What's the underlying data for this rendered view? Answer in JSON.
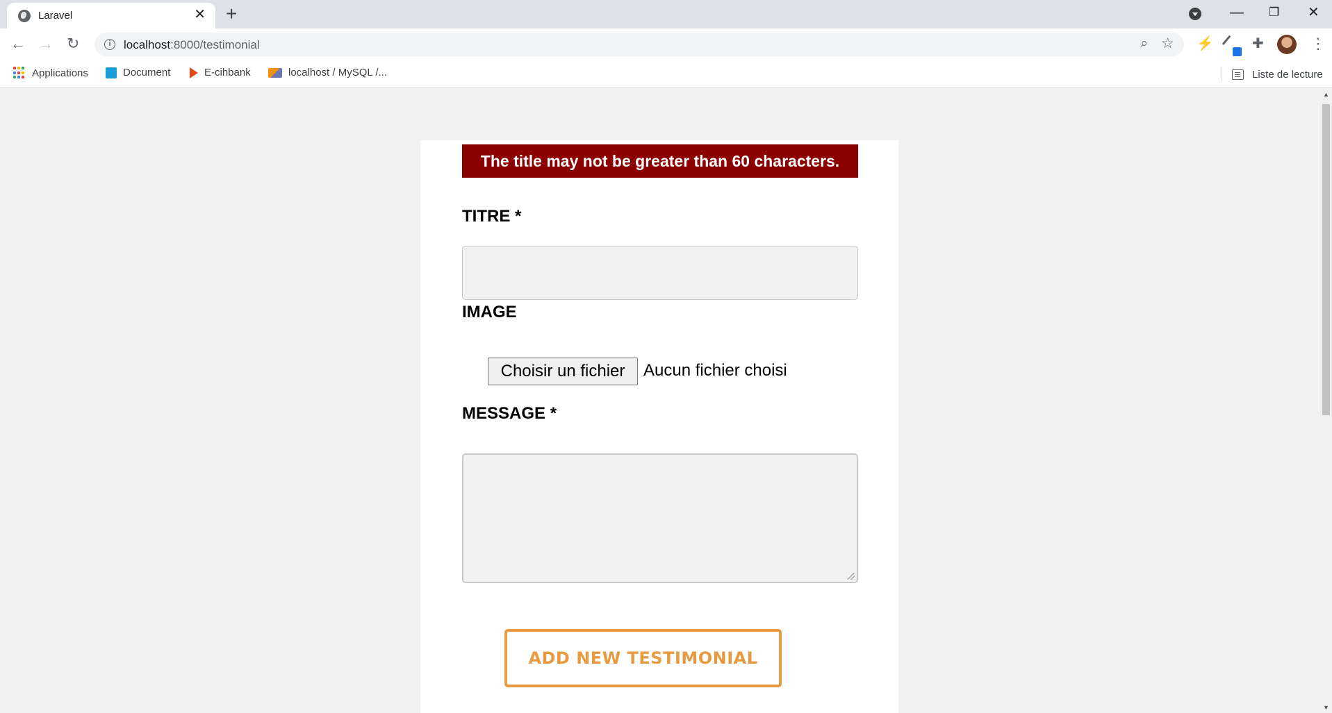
{
  "browser": {
    "tab_title": "Laravel",
    "url_host": "localhost",
    "url_rest": ":8000/testimonial",
    "bookmarks": [
      "Applications",
      "Document",
      "E-cihbank",
      "localhost / MySQL /..."
    ],
    "reading_list": "Liste de lecture"
  },
  "page": {
    "error_message": "The title may not be greater than 60 characters.",
    "title_label": "TITRE *",
    "image_label": "IMAGE",
    "file_button": "Choisir un fichier",
    "file_status": "Aucun fichier choisi",
    "message_label": "MESSAGE *",
    "submit_label": "ADD NEW TESTIMONIAL"
  },
  "colors": {
    "error_bg": "#8b0000",
    "accent": "#e89a41"
  }
}
